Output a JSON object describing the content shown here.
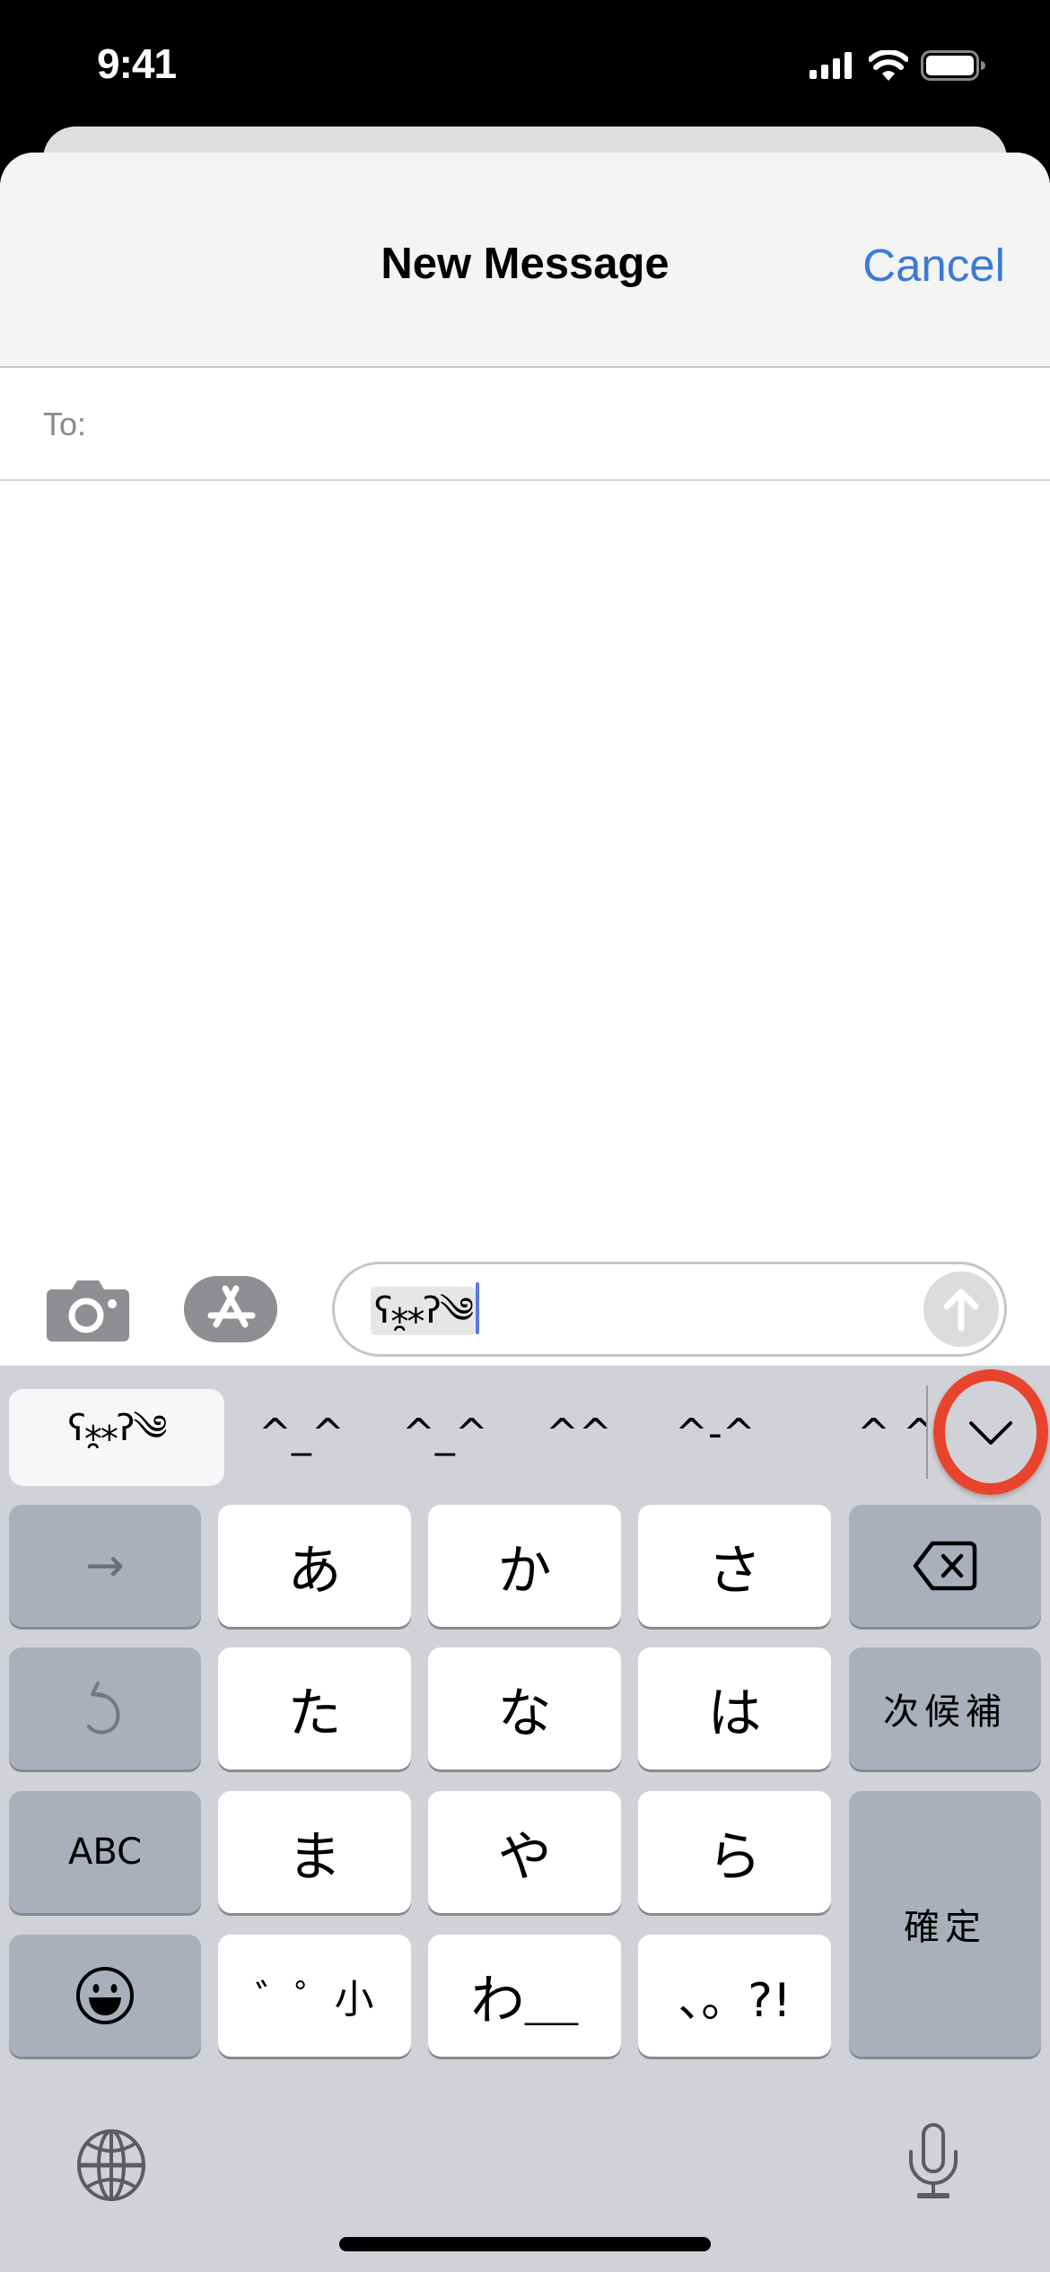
{
  "status_bar": {
    "time": "9:41",
    "icons": [
      "signal-icon",
      "wifi-icon",
      "battery-icon"
    ]
  },
  "nav": {
    "title": "New Message",
    "cancel_label": "Cancel"
  },
  "recipient": {
    "label": "To:",
    "value": ""
  },
  "composer": {
    "camera_icon": "camera-icon",
    "apps_icon": "app-store-icon",
    "message_text": "ʕ⁎̯⁎ʔ༄",
    "send_icon": "arrow-up-icon"
  },
  "keyboard": {
    "candidates": {
      "selected": "ʕ⁎̯⁎ʔ༄",
      "items": [
        "^_^",
        "^_^",
        "^^",
        "^-^",
        "^ ^"
      ],
      "expand_icon": "chevron-down-icon",
      "highlight_color": "#e8432d"
    },
    "rows": [
      {
        "left": "→",
        "keys": [
          "あ",
          "か",
          "さ"
        ],
        "right": "delete-icon"
      },
      {
        "left": "undo-icon",
        "keys": [
          "た",
          "な",
          "は"
        ],
        "right": "次候補"
      },
      {
        "left": "ABC",
        "keys": [
          "ま",
          "や",
          "ら"
        ],
        "right": "確定"
      },
      {
        "left": "emoji-icon",
        "keys": [
          "゛゜小",
          "わ＿",
          "、。?!"
        ]
      }
    ],
    "globe_icon": "globe-icon",
    "mic_icon": "microphone-icon"
  }
}
